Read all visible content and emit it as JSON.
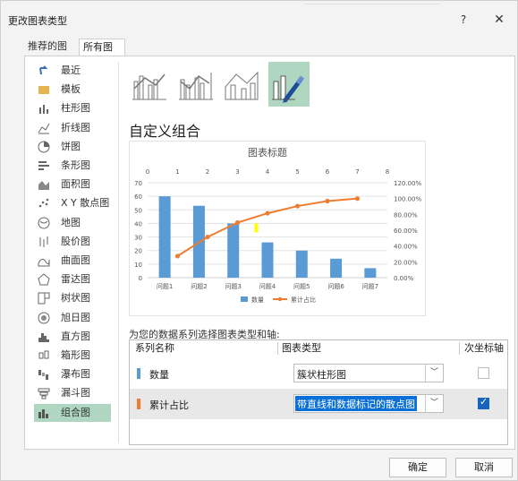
{
  "window": {
    "title": "更改图表类型",
    "help": "?",
    "close": "✕"
  },
  "tabs": [
    {
      "label": "推荐的图表"
    },
    {
      "label": "所有图表"
    }
  ],
  "sidebar": {
    "items": [
      {
        "label": "最近",
        "icon": "recent-icon"
      },
      {
        "label": "模板",
        "icon": "folder-icon"
      },
      {
        "label": "柱形图",
        "icon": "column-chart-icon"
      },
      {
        "label": "折线图",
        "icon": "line-chart-icon"
      },
      {
        "label": "饼图",
        "icon": "pie-chart-icon"
      },
      {
        "label": "条形图",
        "icon": "bar-chart-icon"
      },
      {
        "label": "面积图",
        "icon": "area-chart-icon"
      },
      {
        "label": "X Y 散点图",
        "icon": "scatter-chart-icon"
      },
      {
        "label": "地图",
        "icon": "map-chart-icon"
      },
      {
        "label": "股价图",
        "icon": "stock-chart-icon"
      },
      {
        "label": "曲面图",
        "icon": "surface-chart-icon"
      },
      {
        "label": "雷达图",
        "icon": "radar-chart-icon"
      },
      {
        "label": "树状图",
        "icon": "treemap-chart-icon"
      },
      {
        "label": "旭日图",
        "icon": "sunburst-chart-icon"
      },
      {
        "label": "直方图",
        "icon": "histogram-chart-icon"
      },
      {
        "label": "箱形图",
        "icon": "box-chart-icon"
      },
      {
        "label": "瀑布图",
        "icon": "waterfall-chart-icon"
      },
      {
        "label": "漏斗图",
        "icon": "funnel-chart-icon"
      },
      {
        "label": "组合图",
        "icon": "combo-chart-icon"
      }
    ],
    "active_index": 18
  },
  "section_title": "自定义组合",
  "chart_data": {
    "type": "bar",
    "title": "图表标题",
    "categories": [
      "问题1",
      "问题2",
      "问题3",
      "问题4",
      "问题5",
      "问题6",
      "问题7"
    ],
    "series": [
      {
        "name": "数量",
        "type": "bar",
        "axis": "primary",
        "values": [
          60,
          53,
          40,
          26,
          20,
          14,
          7
        ]
      },
      {
        "name": "累计占比",
        "type": "scatter-line",
        "axis": "secondary",
        "x": [
          1,
          2,
          3,
          4,
          5,
          6,
          7
        ],
        "values": [
          0.273,
          0.514,
          0.696,
          0.814,
          0.905,
          0.968,
          1.0
        ]
      }
    ],
    "ylim": [
      0,
      70
    ],
    "y_ticks": [
      "0",
      "10",
      "20",
      "30",
      "40",
      "50",
      "60",
      "70"
    ],
    "y2lim": [
      0,
      1.2
    ],
    "y2_ticks": [
      "0.00%",
      "20.00%",
      "40.00%",
      "60.00%",
      "80.00%",
      "100.00%",
      "120.00%"
    ],
    "x2lim": [
      0,
      8
    ],
    "x2_ticks": [
      "0",
      "1",
      "2",
      "3",
      "4",
      "5",
      "6",
      "7",
      "8"
    ],
    "legend": "bottom",
    "grid": true,
    "colors": {
      "bar": "#5b9bd5",
      "line": "#ed7d31",
      "highlight": "#ffff00"
    }
  },
  "series_table": {
    "select_label": "为您的数据系列选择图表类型和轴:",
    "headers": {
      "name": "系列名称",
      "type": "图表类型",
      "axis": "次坐标轴"
    },
    "rows": [
      {
        "name": "数量",
        "color": "#5b9bd5",
        "chart_type": "簇状柱形图",
        "secondary": false
      },
      {
        "name": "累计占比",
        "color": "#ed7d31",
        "chart_type": "带直线和数据标记的散点图",
        "secondary": true
      }
    ]
  },
  "buttons": {
    "ok": "确定",
    "cancel": "取消"
  }
}
